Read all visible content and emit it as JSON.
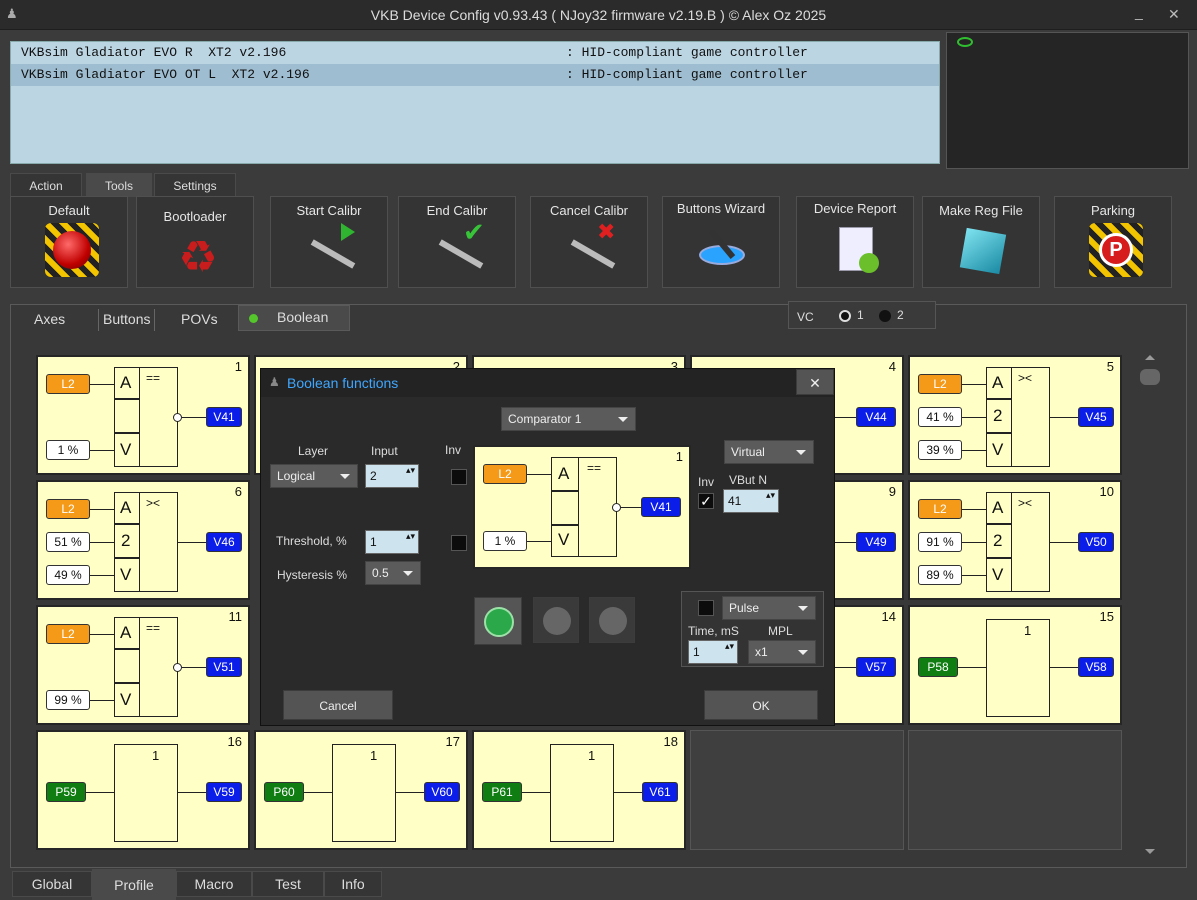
{
  "window": {
    "title": "VKB Device Config v0.93.43 ( NJoy32 firmware v2.19.B ) © Alex Oz 2025",
    "min": "_",
    "close": "✕"
  },
  "devices": [
    {
      "name": "VKBsim Gladiator EVO R  XT2 v2.196",
      "status": ": HID-compliant game controller"
    },
    {
      "name": "VKBsim Gladiator EVO OT L  XT2 v2.196",
      "status": ": HID-compliant game controller"
    }
  ],
  "top_tabs": [
    "Action",
    "Tools",
    "Settings"
  ],
  "tools": [
    "Default",
    "Bootloader",
    "Start Calibr",
    "End Calibr",
    "Cancel Calibr",
    "Buttons Wizard",
    "Device Report",
    "Make Reg File",
    "Parking"
  ],
  "sub_tabs": {
    "axes": "Axes",
    "buttons": "Buttons",
    "povs": "POVs",
    "boolean": "Boolean"
  },
  "vc": {
    "label": "VC",
    "opt1": "1",
    "opt2": "2"
  },
  "cells": [
    {
      "n": "1",
      "in1": "L2",
      "in2": "1 %",
      "op": "==",
      "out": "V41",
      "a": "A",
      "b": "",
      "c": "V"
    },
    {
      "n": "2"
    },
    {
      "n": "3"
    },
    {
      "n": "4",
      "out": "V44"
    },
    {
      "n": "5",
      "in1": "L2",
      "in2": "41 %",
      "in3": "39 %",
      "op": "><",
      "out": "V45",
      "a": "A",
      "b": "2",
      "c": "V"
    },
    {
      "n": "6",
      "in1": "L2",
      "in2": "51 %",
      "in3": "49 %",
      "op": "><",
      "out": "V46",
      "a": "A",
      "b": "2",
      "c": "V"
    },
    {
      "n": "9",
      "out": "V49"
    },
    {
      "n": "10",
      "in1": "L2",
      "in2": "91 %",
      "in3": "89 %",
      "op": "><",
      "out": "V50",
      "a": "A",
      "b": "2",
      "c": "V"
    },
    {
      "n": "11",
      "in1": "L2",
      "in2": "99 %",
      "op": "==",
      "out": "V51",
      "a": "A",
      "b": "",
      "c": "V"
    },
    {
      "n": "14",
      "out": "V57"
    },
    {
      "n": "15",
      "in1": "P58",
      "op": "1",
      "out": "V58"
    },
    {
      "n": "16",
      "in1": "P59",
      "op": "1",
      "out": "V59"
    },
    {
      "n": "17",
      "in1": "P60",
      "op": "1",
      "out": "V60"
    },
    {
      "n": "18",
      "in1": "P61",
      "op": "1",
      "out": "V61"
    }
  ],
  "dialog": {
    "title": "Boolean functions",
    "close": "✕",
    "function": "Comparator 1",
    "layer_label": "Layer",
    "layer_value": "Logical",
    "input_label": "Input",
    "input_value": "2",
    "inv_label": "Inv",
    "threshold_label": "Threshold, %",
    "threshold_value": "1",
    "hyst_label": "Hysteresis %",
    "hyst_value": "0.5",
    "preview": {
      "n": "1",
      "in1": "L2",
      "in2": "1 %",
      "op": "==",
      "out": "V41",
      "a": "A",
      "c": "V"
    },
    "out_type": "Virtual",
    "out_inv_label": "Inv",
    "vbut_label": "VBut N",
    "vbut_value": "41",
    "pulse": "Pulse",
    "time_label": "Time, mS",
    "mpl_label": "MPL",
    "time_value": "1",
    "mpl_value": "x1",
    "cancel": "Cancel",
    "ok": "OK"
  },
  "bottom_tabs": [
    "Global",
    "Profile",
    "Macro",
    "Test",
    "Info"
  ]
}
